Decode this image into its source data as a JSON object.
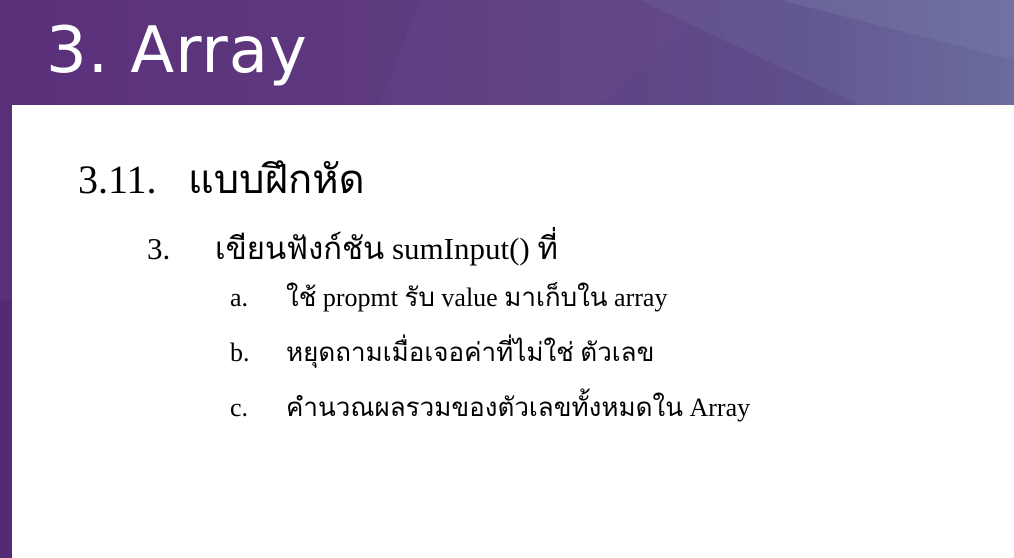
{
  "slide": {
    "title": "3. Array"
  },
  "section": {
    "number": "3.11.",
    "title": "แบบฝึกหัด"
  },
  "exercise": {
    "number": "3.",
    "text": "เขียนฟังก์ชัน sumInput() ที่"
  },
  "subitems": [
    {
      "letter": "a.",
      "text": "ใช้ propmt รับ value มาเก็บใน array"
    },
    {
      "letter": "b.",
      "text": "หยุดถามเมื่อเจอค่าที่ไม่ใช่ ตัวเลข"
    },
    {
      "letter": "c.",
      "text": "คำนวณผลรวมของตัวเลขทั้งหมดใน Array"
    }
  ],
  "colors": {
    "header_purple": "#5a2f7a",
    "header_blue_gray": "#6a6e9f",
    "content_background": "#ffffff",
    "title_text": "#ffffff",
    "body_text": "#000000"
  }
}
